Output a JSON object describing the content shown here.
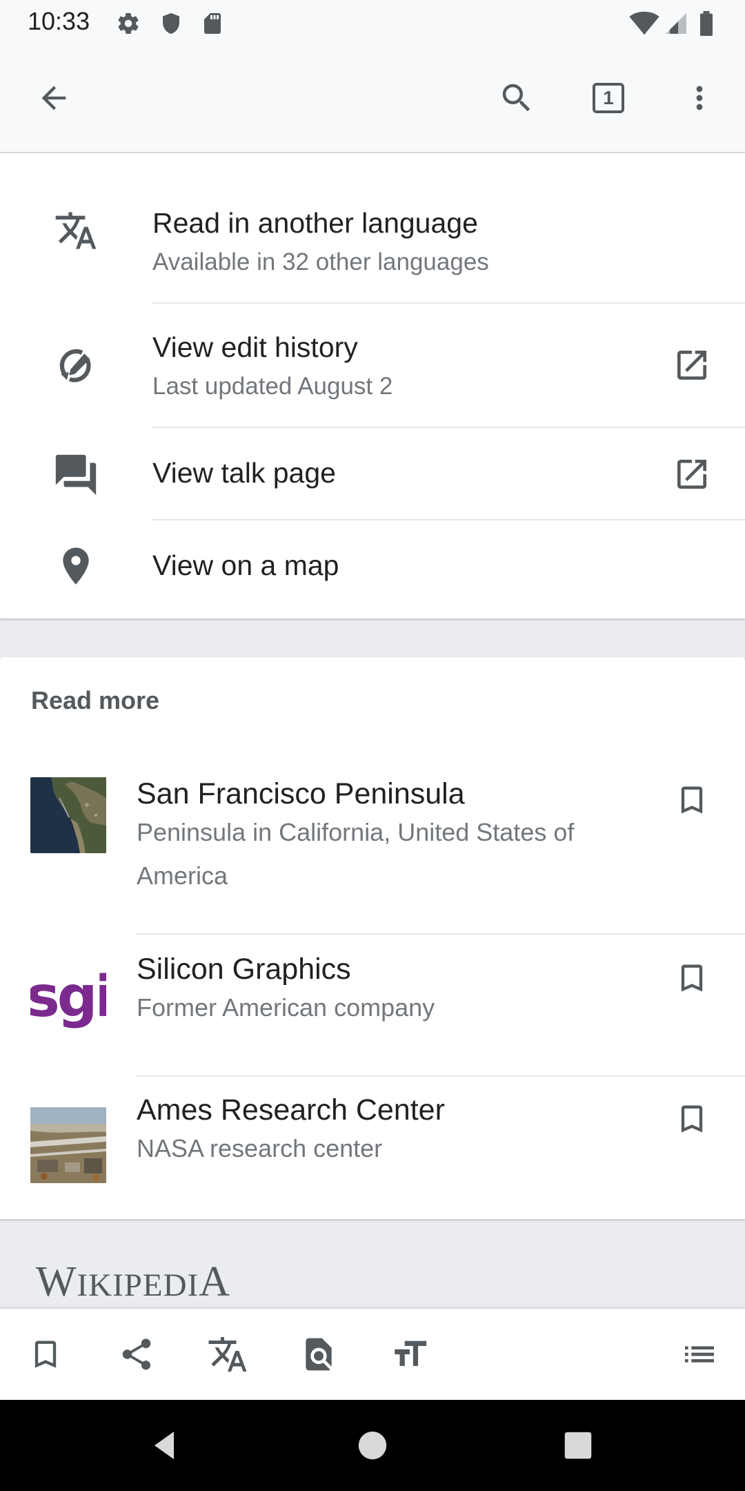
{
  "status_bar": {
    "time": "10:33",
    "left_icons": [
      "gear-icon",
      "shield-icon",
      "sd-card-icon"
    ],
    "right_icons": [
      "wifi-icon",
      "signal-icon",
      "battery-icon"
    ]
  },
  "app_bar": {
    "back_icon": "arrow-back-icon",
    "search_icon": "search-icon",
    "tabs_count": "1",
    "overflow_icon": "more-vert-icon"
  },
  "page_actions": [
    {
      "icon": "translate-icon",
      "title": "Read in another language",
      "subtitle": "Available in 32 other languages",
      "external": false
    },
    {
      "icon": "edit-history-icon",
      "title": "View edit history",
      "subtitle": "Last updated August 2",
      "external": true
    },
    {
      "icon": "talk-bubbles-icon",
      "title": "View talk page",
      "subtitle": "",
      "external": true
    },
    {
      "icon": "map-pin-icon",
      "title": "View on a map",
      "subtitle": "",
      "external": false
    }
  ],
  "read_more": {
    "heading": "Read more",
    "items": [
      {
        "title": "San Francisco Peninsula",
        "description": "Peninsula in California, United States of America",
        "thumb": "satellite"
      },
      {
        "title": "Silicon Graphics",
        "description": "Former American company",
        "thumb": "sgi-logo",
        "logo_text": "sgi"
      },
      {
        "title": "Ames Research Center",
        "description": "NASA research center",
        "thumb": "aerial"
      }
    ]
  },
  "footer": {
    "wordmark": "WIKIPEDIA",
    "wordmark_parts": [
      "W",
      "IKIPEDI",
      "A"
    ]
  },
  "bottom_toolbar": {
    "icons": [
      "bookmark-icon",
      "share-icon",
      "translate-icon",
      "find-in-page-icon",
      "text-size-icon",
      "contents-list-icon"
    ]
  },
  "nav_bar": {
    "icons": [
      "nav-back-icon",
      "nav-home-icon",
      "nav-recents-icon"
    ]
  },
  "colors": {
    "background": "#eaecf0",
    "card": "#ffffff",
    "text_primary": "#202122",
    "text_secondary": "#72777d",
    "icon": "#54595d",
    "sgi_purple": "#7b2a8e"
  }
}
